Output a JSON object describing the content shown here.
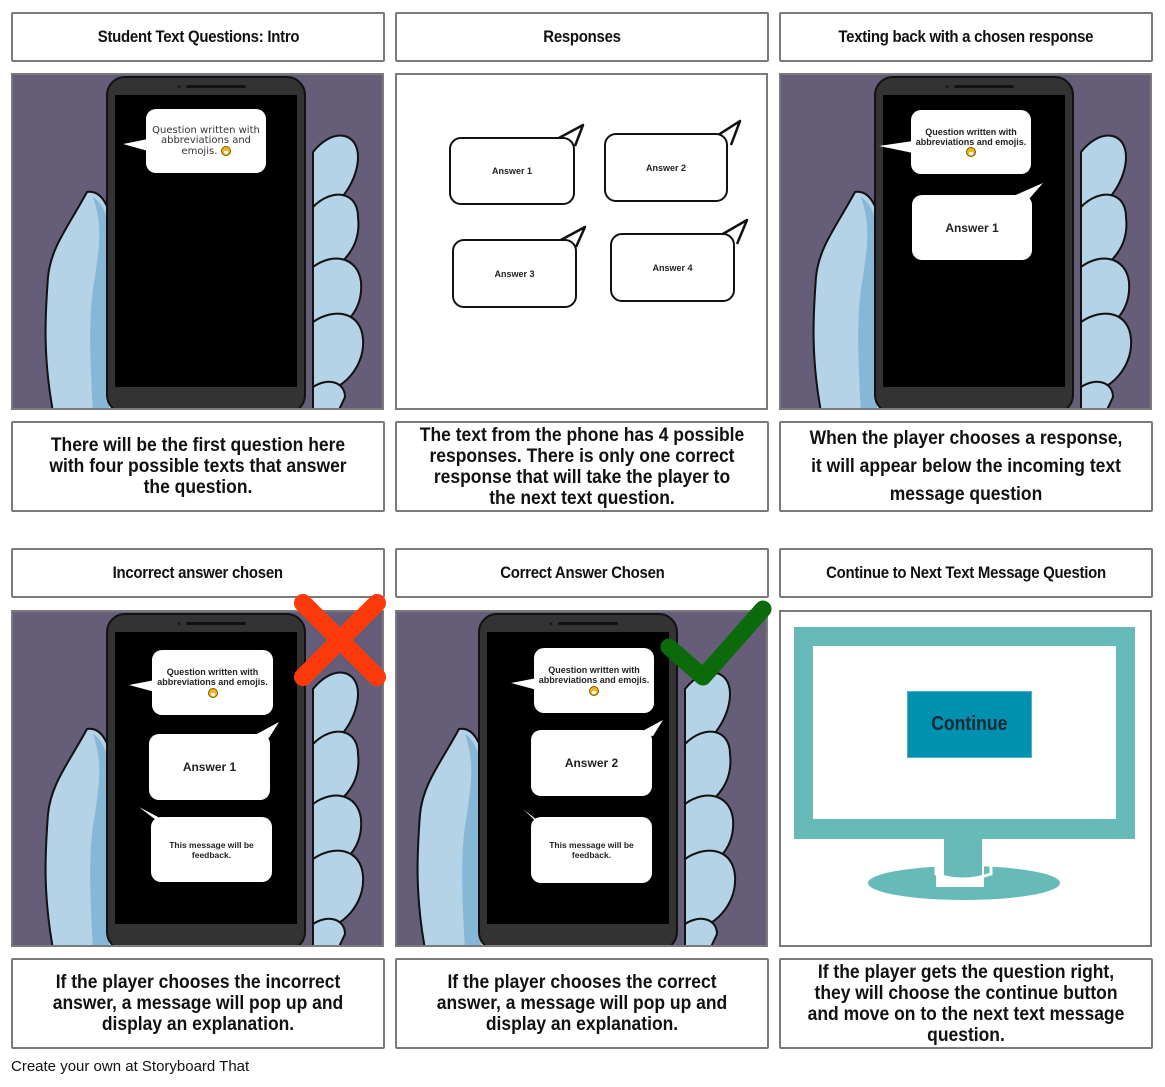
{
  "panels": [
    {
      "title": "Student Text Questions: Intro",
      "description": "There will be the first question here with four possible texts that answer the question.",
      "question_bubble": "Question written with abbreviations and emojis."
    },
    {
      "title": "Responses",
      "description": "The text from the phone has 4 possible responses. There is only one correct response that will take the player to the next text question.",
      "answers": [
        "Answer 1",
        "Answer 2",
        "Answer 3",
        "Answer 4"
      ]
    },
    {
      "title": "Texting back with a chosen response",
      "description": "When the player chooses a response, it will appear below the incoming text message question",
      "question_bubble": "Question written with abbreviations and emojis.",
      "answer_bubble": "Answer 1"
    },
    {
      "title": "Incorrect answer chosen",
      "description": "If the player chooses the incorrect answer, a message will pop up and display an explanation.",
      "question_bubble": "Question written with abbreviations and emojis.",
      "answer_bubble": "Answer 1",
      "feedback_bubble": "This message will be feedback.",
      "status_icon": "red-x-icon"
    },
    {
      "title": "Correct Answer Chosen",
      "description": "If the player chooses the correct answer, a message will pop up and display an explanation.",
      "question_bubble": "Question written with abbreviations and emojis.",
      "answer_bubble": "Answer 2",
      "feedback_bubble": "This message will be feedback.",
      "status_icon": "green-check-icon"
    },
    {
      "title": "Continue to Next Text Message Question",
      "description": "If the player gets the question right, they will choose the continue button and move on to the next text message question.",
      "button_label": "Continue"
    }
  ],
  "colors": {
    "scene_background": "#665d79",
    "hand": "#b5d3e7",
    "hand_shadow": "#86b7d6",
    "phone_body": "#333333",
    "x_mark": "#ff3a0a",
    "check_mark": "#0b6b0b",
    "monitor": "#66bab8",
    "continue_button": "#0090b0"
  },
  "footer": "Create your own at Storyboard That"
}
